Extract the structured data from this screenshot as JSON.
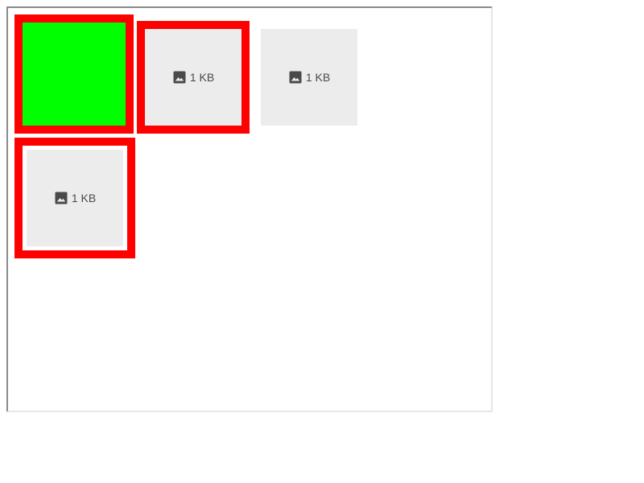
{
  "tiles": [
    {
      "kind": "solid",
      "color": "#00ff00",
      "outlined": true
    },
    {
      "kind": "placeholder",
      "size_label": "1 KB",
      "icon": "image-icon",
      "outlined": true
    },
    {
      "kind": "placeholder",
      "size_label": "1 KB",
      "icon": "image-icon",
      "outlined": false
    },
    {
      "kind": "placeholder",
      "size_label": "1 KB",
      "icon": "image-icon",
      "outlined": true
    }
  ],
  "colors": {
    "outline": "#ff0000",
    "solid_fill": "#00ff00",
    "placeholder_bg": "#ececec",
    "placeholder_text": "#4a4a4a"
  }
}
